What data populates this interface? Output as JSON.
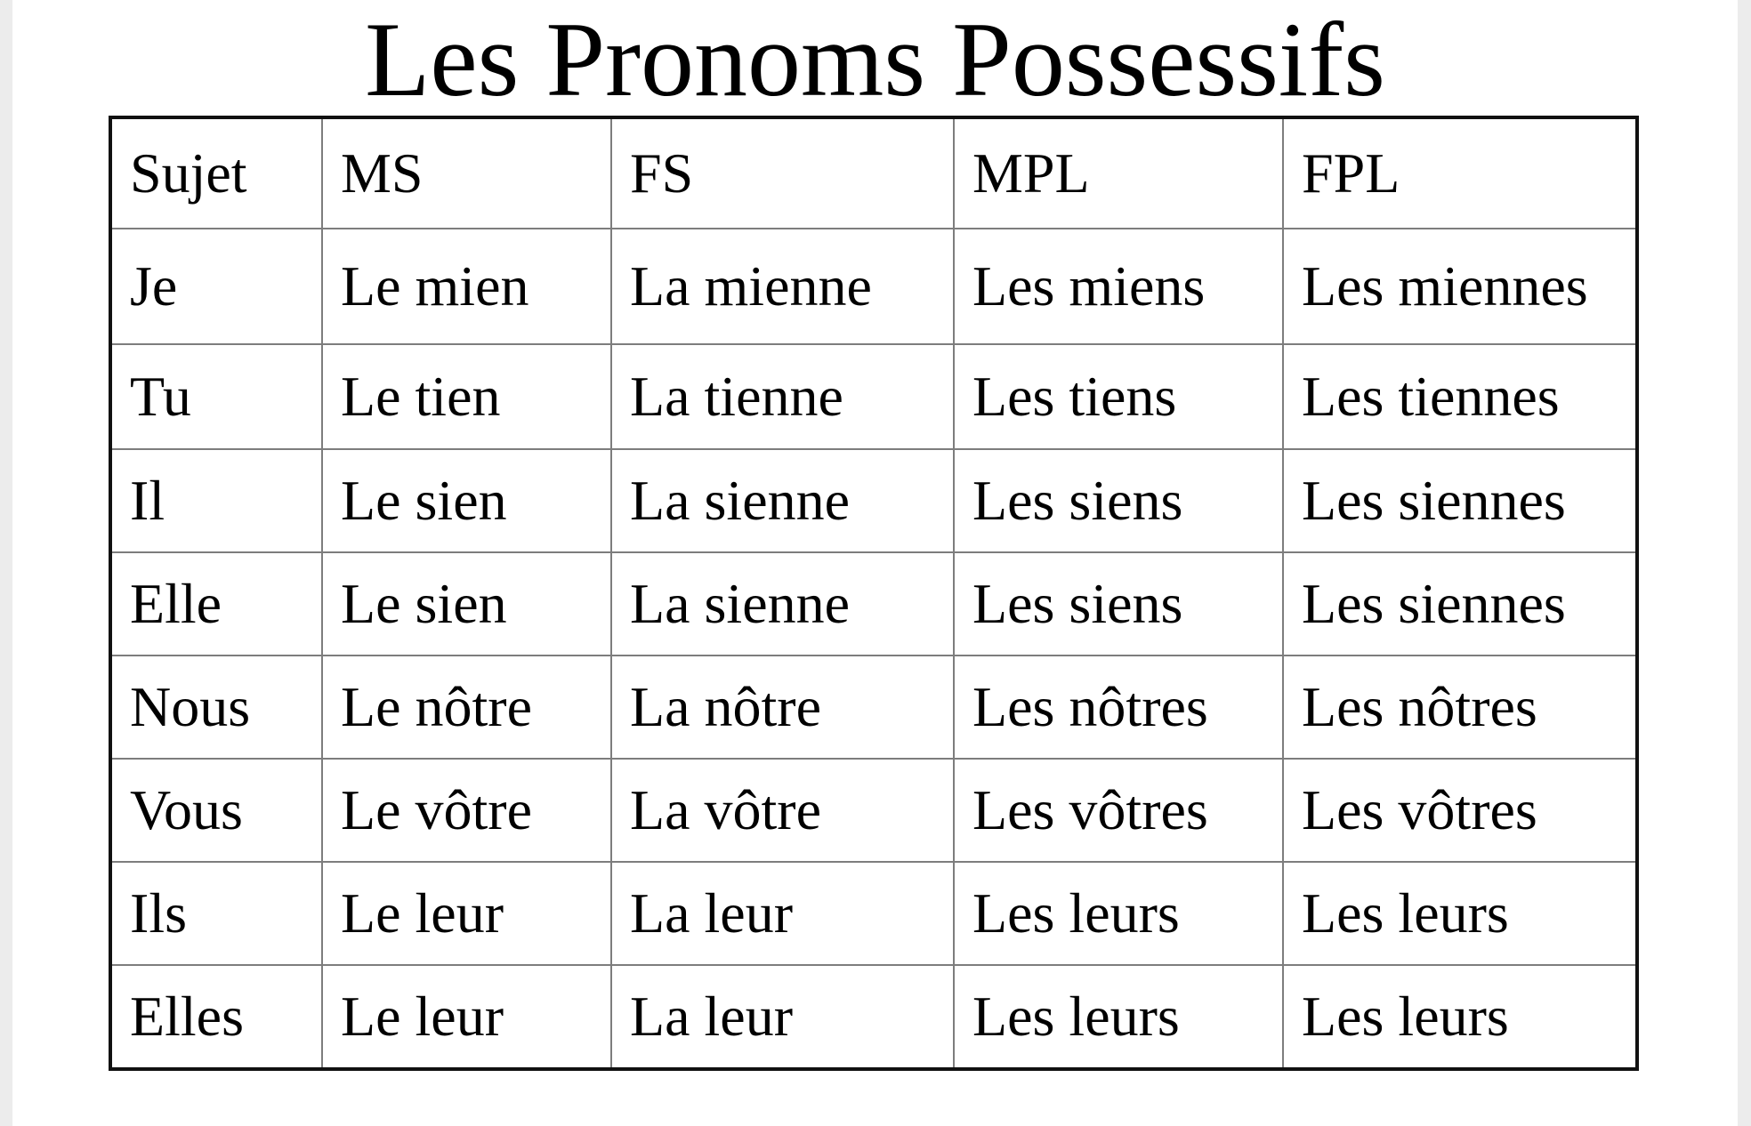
{
  "title": "Les Pronoms Possessifs",
  "table": {
    "headers": [
      "Sujet",
      "MS",
      "FS",
      "MPL",
      "FPL"
    ],
    "rows": [
      [
        "Je",
        "Le mien",
        "La mienne",
        "Les miens",
        "Les miennes"
      ],
      [
        "Tu",
        "Le tien",
        "La tienne",
        "Les tiens",
        "Les tiennes"
      ],
      [
        "Il",
        "Le sien",
        "La sienne",
        "Les siens",
        "Les siennes"
      ],
      [
        "Elle",
        "Le sien",
        "La sienne",
        "Les siens",
        "Les siennes"
      ],
      [
        "Nous",
        "Le nôtre",
        "La nôtre",
        "Les nôtres",
        "Les nôtres"
      ],
      [
        "Vous",
        "Le vôtre",
        "La vôtre",
        "Les vôtres",
        "Les vôtres"
      ],
      [
        "Ils",
        "Le leur",
        "La leur",
        "Les leurs",
        "Les leurs"
      ],
      [
        "Elles",
        "Le leur",
        "La leur",
        "Les leurs",
        "Les leurs"
      ]
    ]
  }
}
